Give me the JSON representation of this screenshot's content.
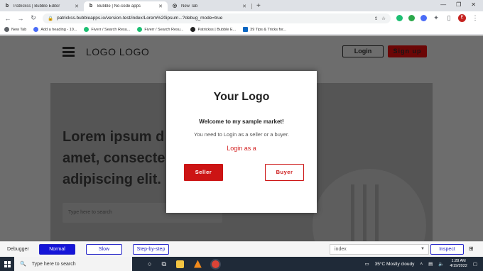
{
  "browser": {
    "tabs": [
      {
        "favicon": "bubble-b",
        "title": "Patrickss | Bubble Editor",
        "active": false
      },
      {
        "favicon": "bubble-b",
        "title": "Bubble | No-code apps",
        "active": true
      },
      {
        "favicon": "chrome-globe",
        "title": "New Tab",
        "active": false
      }
    ],
    "new_tab_label": "+",
    "url": "patrickss.bubbleapps.io/version-test/index/Lorem%20ipsum...?debug_mode=true",
    "profile_initial": "E"
  },
  "bookmarks": [
    {
      "label": "New Tab",
      "color": "#5f6368"
    },
    {
      "label": "Add a heading - 10...",
      "color": "#4a6cf7"
    },
    {
      "label": "Fiverr / Search Resu...",
      "color": "#1dbf73"
    },
    {
      "label": "Fiverr / Search Resu...",
      "color": "#1dbf73"
    },
    {
      "label": "Patrickss | Bubble E...",
      "color": "#222222"
    },
    {
      "label": "39 Tips & Tricks for...",
      "color": "#0a66c2"
    }
  ],
  "page": {
    "logo_text": "LOGO LOGO",
    "login_label": "Login",
    "signup_label": "Sign up",
    "hero_line1": "Lorem ipsum d",
    "hero_line2": "amet, consecte",
    "hero_line3": "adipiscing elit.",
    "search_placeholder": "Type here to search"
  },
  "modal": {
    "logo": "Your Logo",
    "welcome": "Welcome to my sample market!",
    "need_login": "You need to Login as a seller or a buyer.",
    "login_link": "Login as a",
    "seller_label": "Seller",
    "buyer_label": "Buyer"
  },
  "debugger": {
    "label": "Debugger",
    "normal": "Normal",
    "slow": "Slow",
    "step": "Step-by-step",
    "select_value": "index",
    "inspect": "Inspect"
  },
  "taskbar": {
    "search_placeholder": "Type here to search",
    "weather": "35°C  Mostly cloudy",
    "time": "1:28 AM",
    "date": "4/19/2022"
  }
}
